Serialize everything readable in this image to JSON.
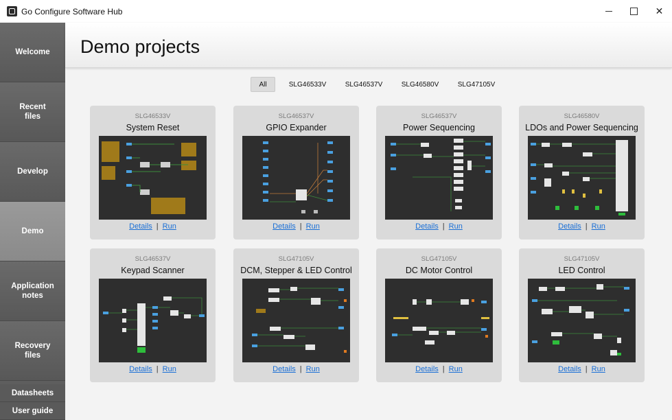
{
  "window": {
    "title": "Go Configure Software Hub",
    "controls": {
      "close": "✕"
    }
  },
  "sidebar": {
    "items": [
      {
        "label": "Welcome",
        "active": false
      },
      {
        "label": "Recent\nfiles",
        "active": false
      },
      {
        "label": "Develop",
        "active": false
      },
      {
        "label": "Demo",
        "active": true
      },
      {
        "label": "Application\nnotes",
        "active": false
      },
      {
        "label": "Recovery\nfiles",
        "active": false
      },
      {
        "label": "Datasheets",
        "active": false
      },
      {
        "label": "User guide",
        "active": false
      }
    ]
  },
  "header": {
    "title": "Demo projects"
  },
  "filters": {
    "options": [
      "All",
      "SLG46533V",
      "SLG46537V",
      "SLG46580V",
      "SLG47105V"
    ],
    "selected": "All"
  },
  "cards": [
    {
      "chip": "SLG46533V",
      "title": "System Reset",
      "details": "Details",
      "run": "Run"
    },
    {
      "chip": "SLG46537V",
      "title": "GPIO Expander",
      "details": "Details",
      "run": "Run"
    },
    {
      "chip": "SLG46537V",
      "title": "Power Sequencing",
      "details": "Details",
      "run": "Run"
    },
    {
      "chip": "SLG46580V",
      "title": "LDOs and Power Sequencing",
      "details": "Details",
      "run": "Run"
    },
    {
      "chip": "SLG46537V",
      "title": "Keypad Scanner",
      "details": "Details",
      "run": "Run"
    },
    {
      "chip": "SLG47105V",
      "title": "DCM, Stepper & LED Control",
      "details": "Details",
      "run": "Run"
    },
    {
      "chip": "SLG47105V",
      "title": "DC Motor Control",
      "details": "Details",
      "run": "Run"
    },
    {
      "chip": "SLG47105V",
      "title": "LED Control",
      "details": "Details",
      "run": "Run"
    }
  ],
  "link_separator": "|",
  "colors": {
    "sidebar": "#5e5e5e",
    "sidebar_active": "#8f8f8f",
    "card_bg": "#dadada",
    "thumb_bg": "#2e2e2e",
    "link": "#1a6fd6"
  }
}
